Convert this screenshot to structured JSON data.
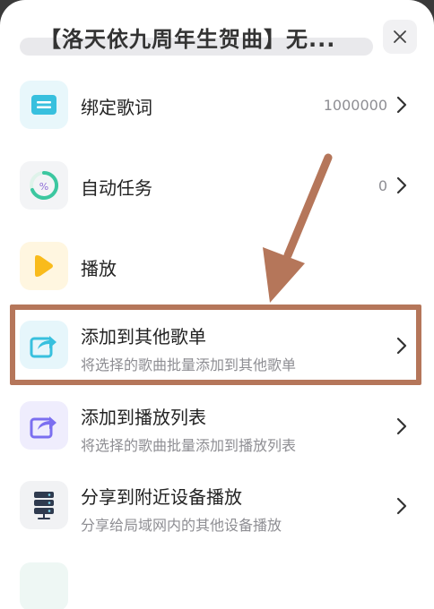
{
  "header": {
    "title": "【洛天依九周年生贺曲】无..."
  },
  "menu": [
    {
      "label": "绑定歌词",
      "value": "1000000",
      "icon": "lyrics-icon"
    },
    {
      "label": "自动任务",
      "value": "0",
      "icon": "timer-icon"
    },
    {
      "label": "播放",
      "icon": "play-icon"
    },
    {
      "label": "添加到其他歌单",
      "sub": "将选择的歌曲批量添加到其他歌单",
      "icon": "share-to-playlist-icon"
    },
    {
      "label": "添加到播放列表",
      "sub": "将选择的歌曲批量添加到播放列表",
      "icon": "share-to-queue-icon"
    },
    {
      "label": "分享到附近设备播放",
      "sub": "分享给局域网内的其他设备播放",
      "icon": "server-icon"
    },
    {
      "label": "",
      "icon": "partial-icon"
    }
  ],
  "colors": {
    "highlight": "#b5765a",
    "cyan": "#38c0de",
    "yellow": "#f9bb1c",
    "purple": "#7b6ff0"
  }
}
